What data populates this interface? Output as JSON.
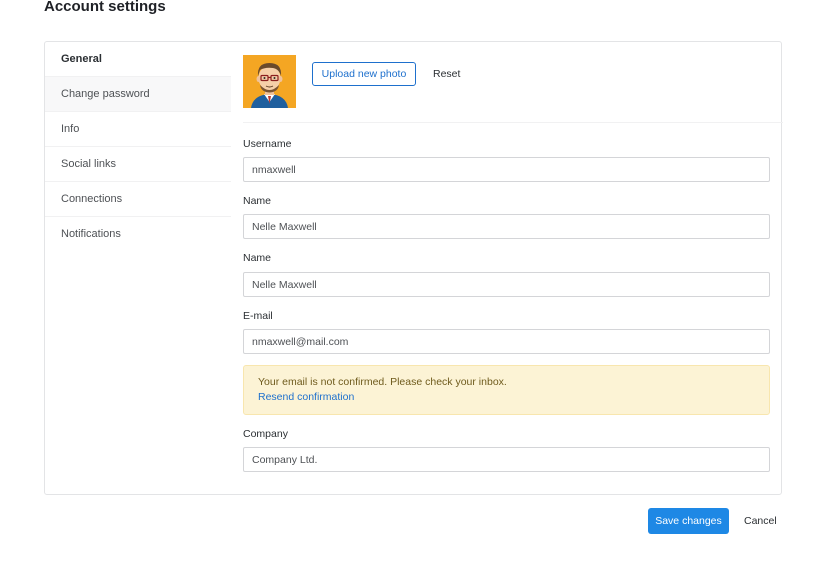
{
  "page": {
    "title": "Account settings"
  },
  "sidebar": {
    "items": [
      {
        "label": "General"
      },
      {
        "label": "Change password"
      },
      {
        "label": "Info"
      },
      {
        "label": "Social links"
      },
      {
        "label": "Connections"
      },
      {
        "label": "Notifications"
      }
    ]
  },
  "photo": {
    "upload_label": "Upload new photo",
    "reset_label": "Reset"
  },
  "form": {
    "username": {
      "label": "Username",
      "value": "nmaxwell"
    },
    "name": {
      "label": "Name",
      "value": "Nelle Maxwell"
    },
    "name2": {
      "label": "Name",
      "value": "Nelle Maxwell"
    },
    "email": {
      "label": "E-mail",
      "value": "nmaxwell@mail.com"
    },
    "alert": {
      "text": "Your email is not confirmed. Please check your inbox.",
      "link": "Resend confirmation"
    },
    "company": {
      "label": "Company",
      "value": "Company Ltd."
    }
  },
  "footer": {
    "save_label": "Save changes",
    "cancel_label": "Cancel"
  },
  "colors": {
    "accent": "#1e88e5",
    "link": "#1e70cd",
    "alert_bg": "#fcf3d5",
    "avatar_bg": "#f4a623"
  }
}
